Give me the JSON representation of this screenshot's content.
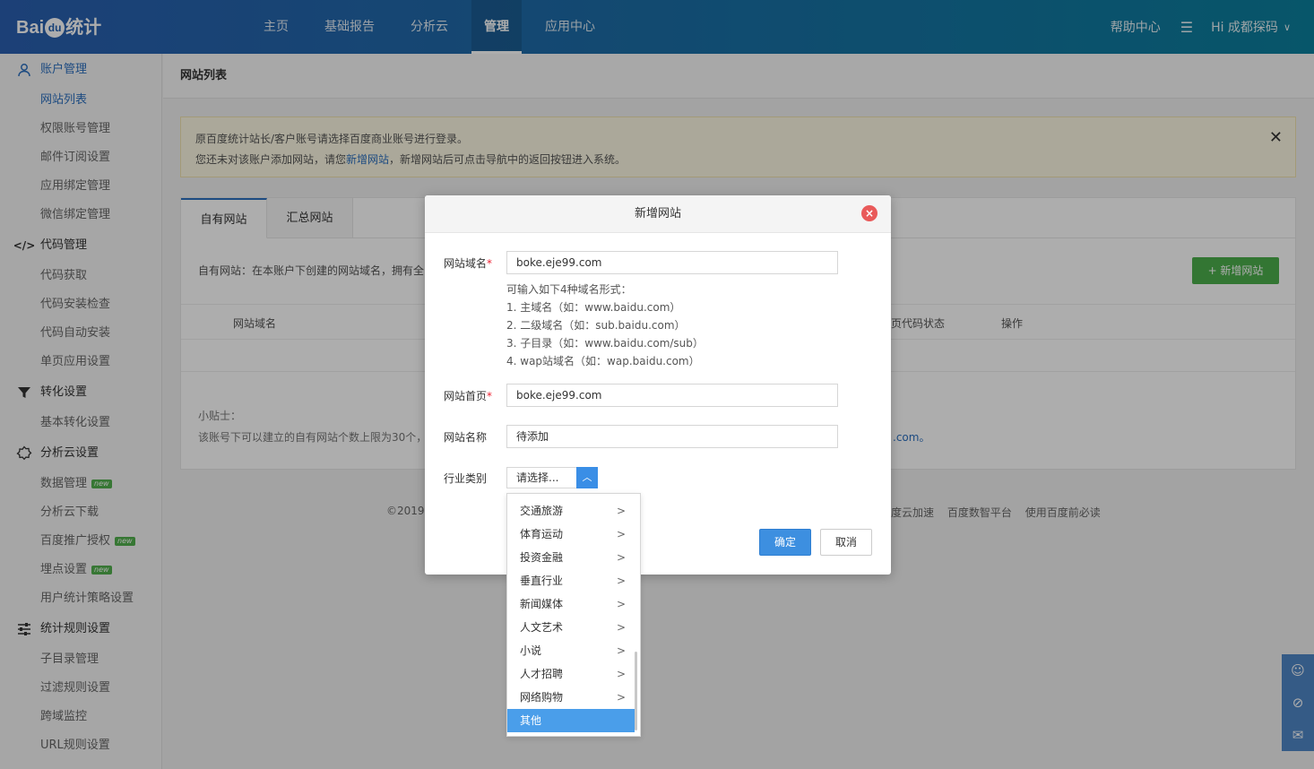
{
  "header": {
    "logo_text": "Bai",
    "logo_paw": "du",
    "logo_cn": "统计",
    "nav": [
      "主页",
      "基础报告",
      "分析云",
      "管理",
      "应用中心"
    ],
    "active_nav": "管理",
    "help": "帮助中心",
    "greeting": "Hi  成都探码"
  },
  "sidebar": {
    "groups": [
      {
        "label": "账户管理",
        "icon": "user-icon",
        "items": [
          "网站列表",
          "权限账号管理",
          "邮件订阅设置",
          "应用绑定管理",
          "微信绑定管理"
        ]
      },
      {
        "label": "代码管理",
        "icon": "code-icon",
        "items": [
          "代码获取",
          "代码安装检查",
          "代码自动安装",
          "单页应用设置"
        ]
      },
      {
        "label": "转化设置",
        "icon": "funnel-icon",
        "items": [
          "基本转化设置"
        ]
      },
      {
        "label": "分析云设置",
        "icon": "cloud-icon",
        "items": [
          "数据管理",
          "分析云下载",
          "百度推广授权",
          "埋点设置",
          "用户统计策略设置"
        ]
      },
      {
        "label": "统计规则设置",
        "icon": "sliders-icon",
        "items": [
          "子目录管理",
          "过滤规则设置",
          "跨域监控",
          "URL规则设置"
        ]
      }
    ],
    "new_badge": "new"
  },
  "main": {
    "breadcrumb": "网站列表",
    "notice_line1": "原百度统计站长/客户账号请选择百度商业账号进行登录。",
    "notice_line2_a": "您还未对该账户添加网站，请您",
    "notice_link": "新增网站",
    "notice_line2_b": "，新增网站后可点击导航中的返回按钮进入系统。",
    "tabs": [
      "自有网站",
      "汇总网站"
    ],
    "desc": "自有网站：在本账户下创建的网站域名，拥有全",
    "add_button": "+ 新增网站",
    "col_domain": "网站域名",
    "col_status": "页代码状态",
    "col_action": "操作",
    "tip_title": "小贴士：",
    "tip_text": "该账号下可以建立的自有网站个数上限为30个，",
    "tip_tail": ".com。",
    "footer_left": "©2019 B",
    "footer_links": [
      "度云加速",
      "百度数智平台",
      "使用百度前必读"
    ]
  },
  "modal": {
    "title": "新增网站",
    "domain_label": "网站域名",
    "domain_value": "boke.eje99.com",
    "hint_title": "可输入如下4种域名形式：",
    "hints": [
      "1. 主域名（如：www.baidu.com）",
      "2. 二级域名（如：sub.baidu.com）",
      "3. 子目录（如：www.baidu.com/sub）",
      "4. wap站域名（如：wap.baidu.com）"
    ],
    "home_label": "网站首页",
    "home_value": "boke.eje99.com",
    "name_label": "网站名称",
    "name_value": "待添加",
    "industry_label": "行业类别",
    "industry_placeholder": "请选择...",
    "ok": "确定",
    "cancel": "取消",
    "required_mark": "*"
  },
  "dropdown": {
    "items": [
      "交通旅游",
      "体育运动",
      "投资金融",
      "垂直行业",
      "新闻媒体",
      "人文艺术",
      "小说",
      "人才招聘",
      "网络购物",
      "其他"
    ],
    "selected": "其他"
  },
  "colors": {
    "nav_gradient_start": "#2a5fb0",
    "nav_gradient_end": "#0b7f9c",
    "accent": "#2c6fbe",
    "green": "#4cae4c",
    "danger": "#e95a5a"
  }
}
